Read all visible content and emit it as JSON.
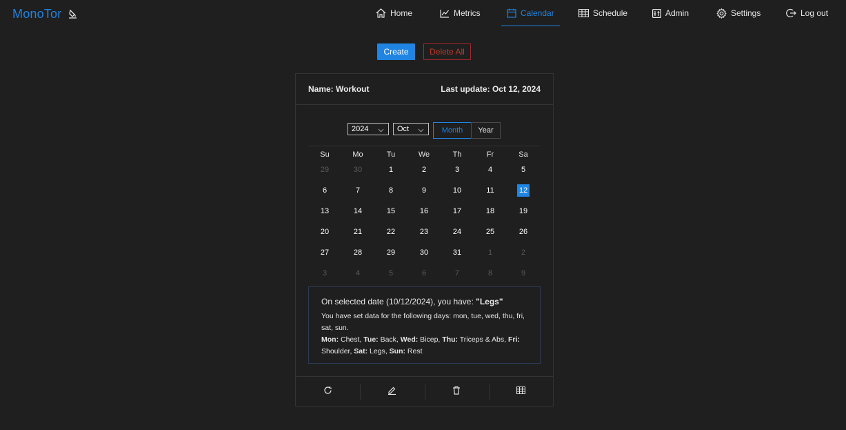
{
  "brand": {
    "name": "MonoTor"
  },
  "nav": {
    "items": [
      {
        "label": "Home",
        "icon": "home-icon",
        "active": false
      },
      {
        "label": "Metrics",
        "icon": "chart-line-icon",
        "active": false
      },
      {
        "label": "Calendar",
        "icon": "calendar-icon",
        "active": true
      },
      {
        "label": "Schedule",
        "icon": "table-icon",
        "active": false
      },
      {
        "label": "Admin",
        "icon": "admin-icon",
        "active": false
      },
      {
        "label": "Settings",
        "icon": "gear-icon",
        "active": false
      },
      {
        "label": "Log out",
        "icon": "logout-icon",
        "active": false
      }
    ]
  },
  "actions": {
    "create": "Create",
    "delete_all": "Delete All"
  },
  "card": {
    "name_label": "Name:",
    "name_value": "Workout",
    "update_label": "Last update:",
    "update_value": "Oct 12, 2024",
    "year_select": "2024",
    "month_select": "Oct",
    "mode_month": "Month",
    "mode_year": "Year"
  },
  "calendar": {
    "weekdays": [
      "Su",
      "Mo",
      "Tu",
      "We",
      "Th",
      "Fr",
      "Sa"
    ],
    "weeks": [
      [
        "29",
        "30",
        "1",
        "2",
        "3",
        "4",
        "5"
      ],
      [
        "6",
        "7",
        "8",
        "9",
        "10",
        "11",
        "12"
      ],
      [
        "13",
        "14",
        "15",
        "16",
        "17",
        "18",
        "19"
      ],
      [
        "20",
        "21",
        "22",
        "23",
        "24",
        "25",
        "26"
      ],
      [
        "27",
        "28",
        "29",
        "30",
        "31",
        "1",
        "2"
      ],
      [
        "3",
        "4",
        "5",
        "6",
        "7",
        "8",
        "9"
      ]
    ],
    "selected_day": "12"
  },
  "info": {
    "title_prefix": "On selected date (10/12/2024), you have: ",
    "title_value": "\"Legs\"",
    "days_text": "You have set data for the following days: mon, tue, wed, thu, fri, sat, sun.",
    "schedule": [
      {
        "day": "Mon:",
        "value": " Chest, "
      },
      {
        "day": "Tue:",
        "value": " Back, "
      },
      {
        "day": "Wed:",
        "value": " Bicep, "
      },
      {
        "day": "Thu:",
        "value": " Triceps & Abs, "
      },
      {
        "day": "Fri:",
        "value": " Shoulder, "
      },
      {
        "day": "Sat:",
        "value": " Legs, "
      },
      {
        "day": "Sun:",
        "value": " Rest"
      }
    ]
  },
  "footer_actions": [
    "refresh-icon",
    "edit-icon",
    "trash-icon",
    "table-icon"
  ],
  "colors": {
    "accent": "#1f84e2",
    "danger": "#a2282c",
    "background": "#1f1f1f"
  }
}
